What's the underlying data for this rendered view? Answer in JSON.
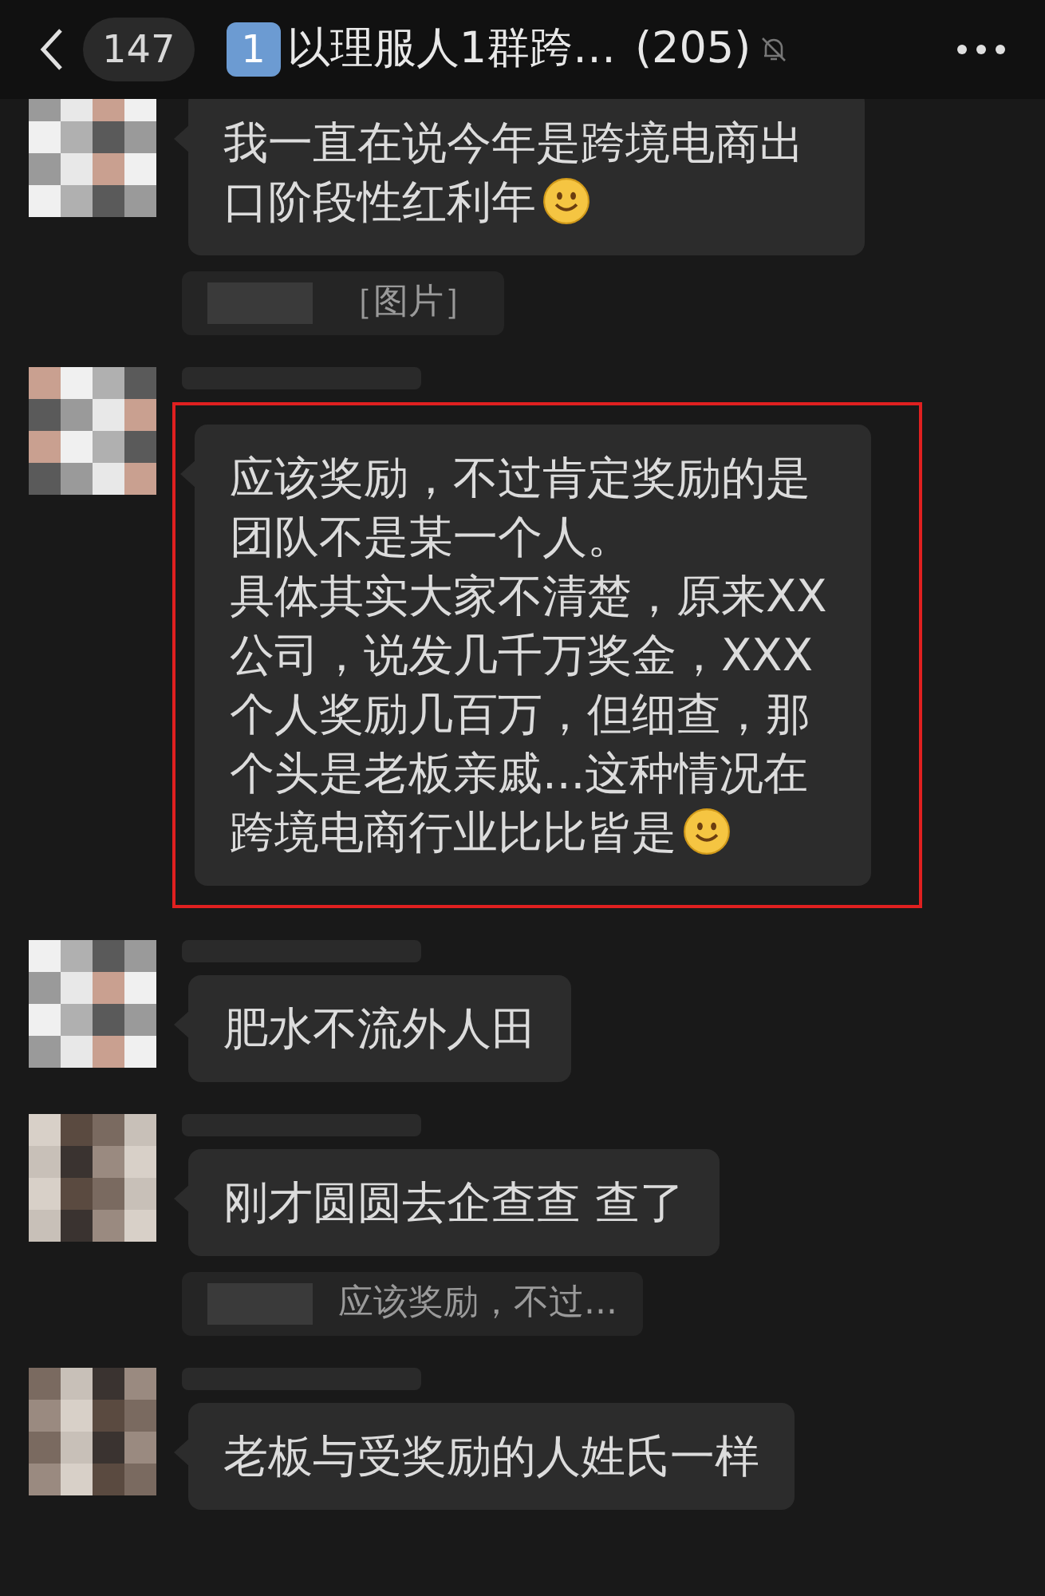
{
  "header": {
    "back_badge": "147",
    "title_keycap": "1",
    "title": "以理服人1群跨…",
    "member_count": "(205)",
    "muted": true
  },
  "messages": [
    {
      "kind": "text",
      "sender_shown": false,
      "paragraphs": [
        "我一直在说今年是跨境电商出口阶段性红利年"
      ],
      "emoji": true,
      "highlighted": false
    },
    {
      "kind": "quote",
      "text": "［图片］"
    },
    {
      "kind": "text",
      "sender_shown": true,
      "paragraphs": [
        "应该奖励，不过肯定奖励的是团队不是某一个人。",
        "具体其实大家不清楚，原来XX公司，说发几千万奖金，XXX个人奖励几百万，但细查，那个头是老板亲戚...这种情况在跨境电商行业比比皆是"
      ],
      "emoji": true,
      "highlighted": true
    },
    {
      "kind": "text",
      "sender_shown": true,
      "paragraphs": [
        "肥水不流外人田"
      ],
      "emoji": false,
      "highlighted": false
    },
    {
      "kind": "text",
      "sender_shown": true,
      "paragraphs": [
        "刚才圆圆去企查查 查了"
      ],
      "emoji": false,
      "highlighted": false
    },
    {
      "kind": "quote",
      "text": "应该奖励，不过..."
    },
    {
      "kind": "text",
      "sender_shown": true,
      "paragraphs": [
        "老板与受奖励的人姓氏一样"
      ],
      "emoji": false,
      "highlighted": false
    }
  ]
}
